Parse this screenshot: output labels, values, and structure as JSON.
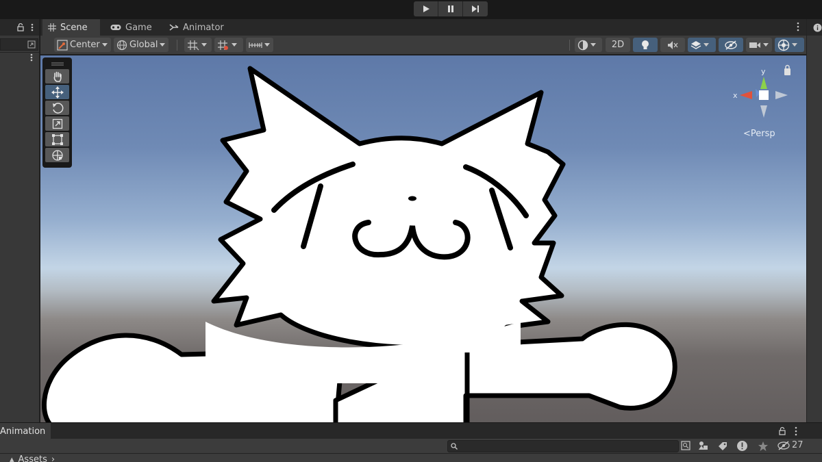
{
  "scene_tabs": [
    {
      "label": "Scene",
      "icon": "grid-icon"
    },
    {
      "label": "Game",
      "icon": "gamepad-icon"
    },
    {
      "label": "Animator",
      "icon": "animator-icon"
    }
  ],
  "toolbar": {
    "pivot_label": "Center",
    "space_label": "Global",
    "mode_2d_label": "2D"
  },
  "scene_view": {
    "camera_label": "<Persp",
    "axis_x": "x",
    "axis_y": "y"
  },
  "animation_panel": {
    "title": "Animation",
    "search_placeholder": "",
    "hidden_count": "27",
    "breadcrumb": "Assets"
  },
  "colors": {
    "accent_blue": "#46607c",
    "axis_x": "#e0523c",
    "axis_y": "#8cd14a"
  }
}
